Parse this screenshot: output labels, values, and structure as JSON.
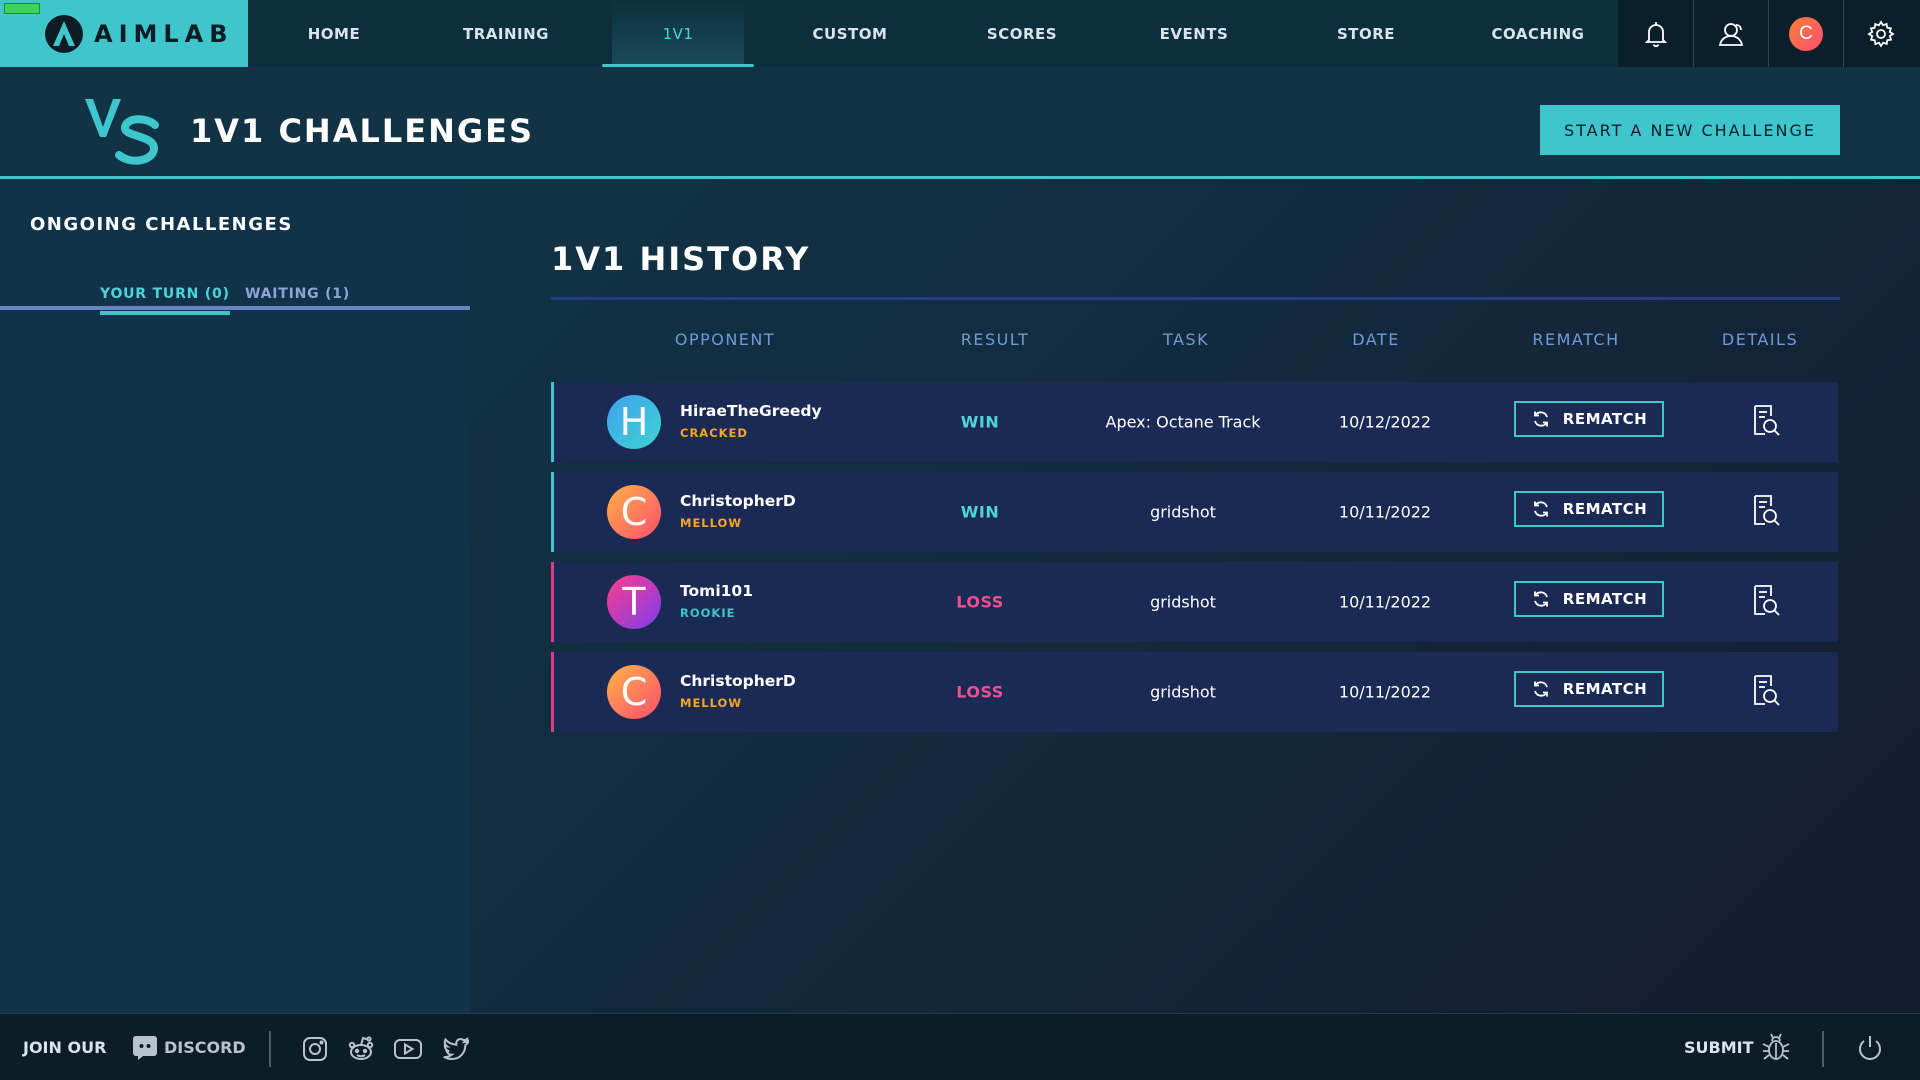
{
  "app": {
    "logo_text": "AIMLAB"
  },
  "nav": {
    "items": [
      {
        "label": "HOME"
      },
      {
        "label": "TRAINING"
      },
      {
        "label": "1V1"
      },
      {
        "label": "CUSTOM"
      },
      {
        "label": "SCORES"
      },
      {
        "label": "EVENTS"
      },
      {
        "label": "STORE"
      },
      {
        "label": "COACHING"
      }
    ],
    "active": "1V1",
    "icons": [
      "bell-icon",
      "friends-icon",
      "profile-avatar",
      "gear-icon"
    ],
    "avatar_letter": "C"
  },
  "header": {
    "title": "1V1 CHALLENGES",
    "start_button": "START A NEW CHALLENGE"
  },
  "sidebar": {
    "title": "ONGOING CHALLENGES",
    "tabs": [
      {
        "label": "YOUR TURN (0)"
      },
      {
        "label": "WAITING (1)"
      }
    ],
    "active_tab": "YOUR TURN (0)"
  },
  "history": {
    "title": "1V1 HISTORY",
    "columns": [
      "OPPONENT",
      "RESULT",
      "TASK",
      "DATE",
      "REMATCH",
      "DETAILS"
    ],
    "rematch_label": "REMATCH",
    "rows": [
      {
        "avatar_letter": "H",
        "opponent": "HiraeTheGreedy",
        "rank": "CRACKED",
        "rank_color": "#f5a623",
        "result": "WIN",
        "task": "Apex: Octane Track",
        "date": "10/12/2022"
      },
      {
        "avatar_letter": "C",
        "opponent": "ChristopherD",
        "rank": "MELLOW",
        "rank_color": "#f5a623",
        "result": "WIN",
        "task": "gridshot",
        "date": "10/11/2022"
      },
      {
        "avatar_letter": "T",
        "opponent": "Tomi101",
        "rank": "ROOKIE",
        "rank_color": "#3fc6cd",
        "result": "LOSS",
        "task": "gridshot",
        "date": "10/11/2022"
      },
      {
        "avatar_letter": "C",
        "opponent": "ChristopherD",
        "rank": "MELLOW",
        "rank_color": "#f5a623",
        "result": "LOSS",
        "task": "gridshot",
        "date": "10/11/2022"
      }
    ]
  },
  "footer": {
    "join_our": "JOIN OUR",
    "discord": "DISCORD",
    "social_icons": [
      "instagram-icon",
      "reddit-icon",
      "youtube-icon",
      "twitter-icon"
    ],
    "submit": "SUBMIT"
  },
  "colors": {
    "accent": "#3fc6cd",
    "win": "#4fd3db",
    "loss": "#f0508f",
    "row_bg": "#1b2a55"
  }
}
